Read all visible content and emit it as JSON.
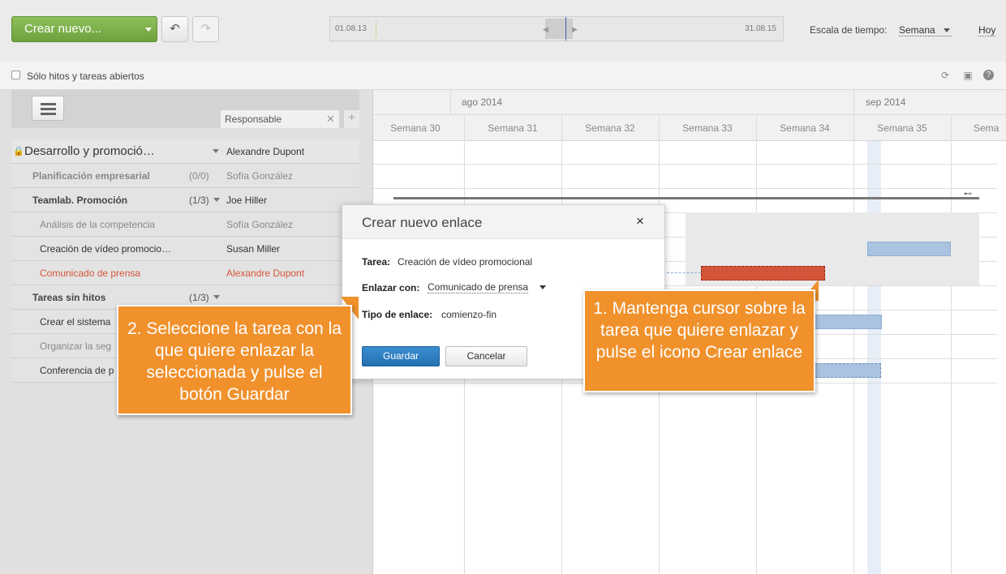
{
  "toolbar": {
    "create_label": "Crear nuevo...",
    "undo_icon": "↶",
    "redo_icon": "↷",
    "timeline_start": "01.08.13",
    "timeline_end": "31.08.15",
    "scale_label": "Escala de tiempo:",
    "scale_value": "Semana",
    "today_label": "Hoy"
  },
  "filter": {
    "label": "Sólo hitos y tareas abiertos"
  },
  "left": {
    "responsible_header": "Responsable",
    "rows": [
      {
        "name": "Desarrollo y promoció…",
        "count": "",
        "responsible": "Alexandre Dupont"
      },
      {
        "name": "Planificación empresarial",
        "count": "(0/0)",
        "responsible": "Sofía González"
      },
      {
        "name": "Teamlab. Promoción",
        "count": "(1/3)",
        "responsible": "Joe Hiller"
      },
      {
        "name": "Análisis de la competencia",
        "count": "",
        "responsible": "Sofía González"
      },
      {
        "name": "Creación de vídeo promocio…",
        "count": "",
        "responsible": "Susan Miller"
      },
      {
        "name": "Comunicado de prensa",
        "count": "",
        "responsible": "Alexandre Dupont"
      },
      {
        "name": "Tareas sin hitos",
        "count": "(1/3)",
        "responsible": ""
      },
      {
        "name": "Crear el sistema",
        "count": "",
        "responsible": ""
      },
      {
        "name": "Organizar la seg",
        "count": "",
        "responsible": ""
      },
      {
        "name": "Conferencia de p",
        "count": "",
        "responsible": ""
      }
    ]
  },
  "gantt": {
    "months": [
      "ago 2014",
      "sep 2014"
    ],
    "weeks": [
      "Semana 30",
      "Semana 31",
      "Semana 32",
      "Semana 33",
      "Semana 34",
      "Semana 35",
      "Sema"
    ]
  },
  "dialog": {
    "title": "Crear nuevo enlace",
    "task_label": "Tarea:",
    "task_value": "Creación de vídeo promocional",
    "link_label": "Enlazar con:",
    "link_value": "Comunicado de prensa",
    "type_label": "Tipo de enlace:",
    "type_value": "comienzo-fin",
    "save_label": "Guardar",
    "cancel_label": "Cancelar",
    "close_icon": "×"
  },
  "callouts": {
    "step1": "1. Mantenga cursor sobre la tarea que quiere enlazar y pulse el icono Crear enlace",
    "step2": "2. Seleccione la tarea con la que quiere enlazar la seleccionada y pulse el botón Guardar"
  },
  "colors": {
    "accent_green": "#7cb248",
    "callout_orange": "#f0912c",
    "overdue_red": "#d4553a",
    "bar_blue": "#a9c3e0",
    "primary_blue": "#2f80c3"
  }
}
